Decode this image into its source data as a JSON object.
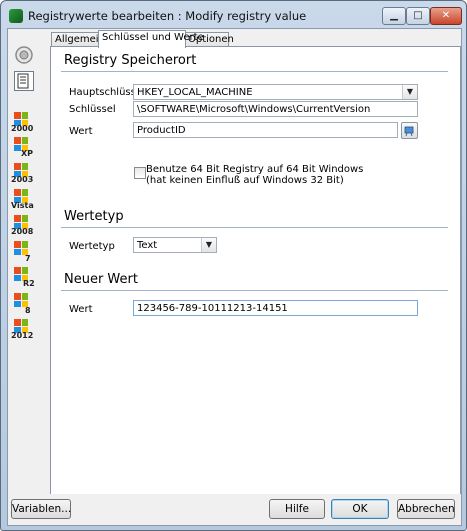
{
  "window": {
    "title": "Registrywerte bearbeiten : Modify registry value",
    "icon": "app-icon",
    "controls": {
      "minimize": "minimize-icon",
      "maximize": "maximize-icon",
      "close": "close-icon"
    }
  },
  "tabs": [
    {
      "label": "Allgemein",
      "active": false
    },
    {
      "label": "Schlüssel und Werte",
      "active": true
    },
    {
      "label": "Optionen",
      "active": false
    }
  ],
  "sidebar": {
    "icons": [
      "target-icon",
      "document-icon"
    ],
    "os_items": [
      "2000",
      "XP",
      "2003",
      "Vista",
      "2008",
      "7",
      "R2",
      "8",
      "2012"
    ]
  },
  "location": {
    "title": "Registry Speicherort",
    "hive_label": "Hauptschlüssel",
    "hive_value": "HKEY_LOCAL_MACHINE",
    "key_label": "Schlüssel",
    "key_value": "\\SOFTWARE\\Microsoft\\Windows\\CurrentVersion",
    "value_label": "Wert",
    "value_value": "ProductID",
    "use64_line1": "Benutze 64 Bit Registry auf 64 Bit Windows",
    "use64_line2": "(hat keinen Einfluß auf Windows 32 Bit)",
    "use64_checked": false
  },
  "type_section": {
    "title": "Wertetyp",
    "type_label": "Wertetyp",
    "type_value": "Text"
  },
  "new_value": {
    "title": "Neuer Wert",
    "value_label": "Wert",
    "value": "123456-789-10111213-14151"
  },
  "footer": {
    "variables": "Variablen...",
    "help": "Hilfe",
    "ok": "OK",
    "cancel": "Abbrechen"
  },
  "colors": {
    "title_gradient": [
      "#c9d9ea",
      "#b5c9de"
    ],
    "flag": [
      "#e94e1b",
      "#7cb518",
      "#1f8fe0",
      "#ffc000"
    ]
  }
}
